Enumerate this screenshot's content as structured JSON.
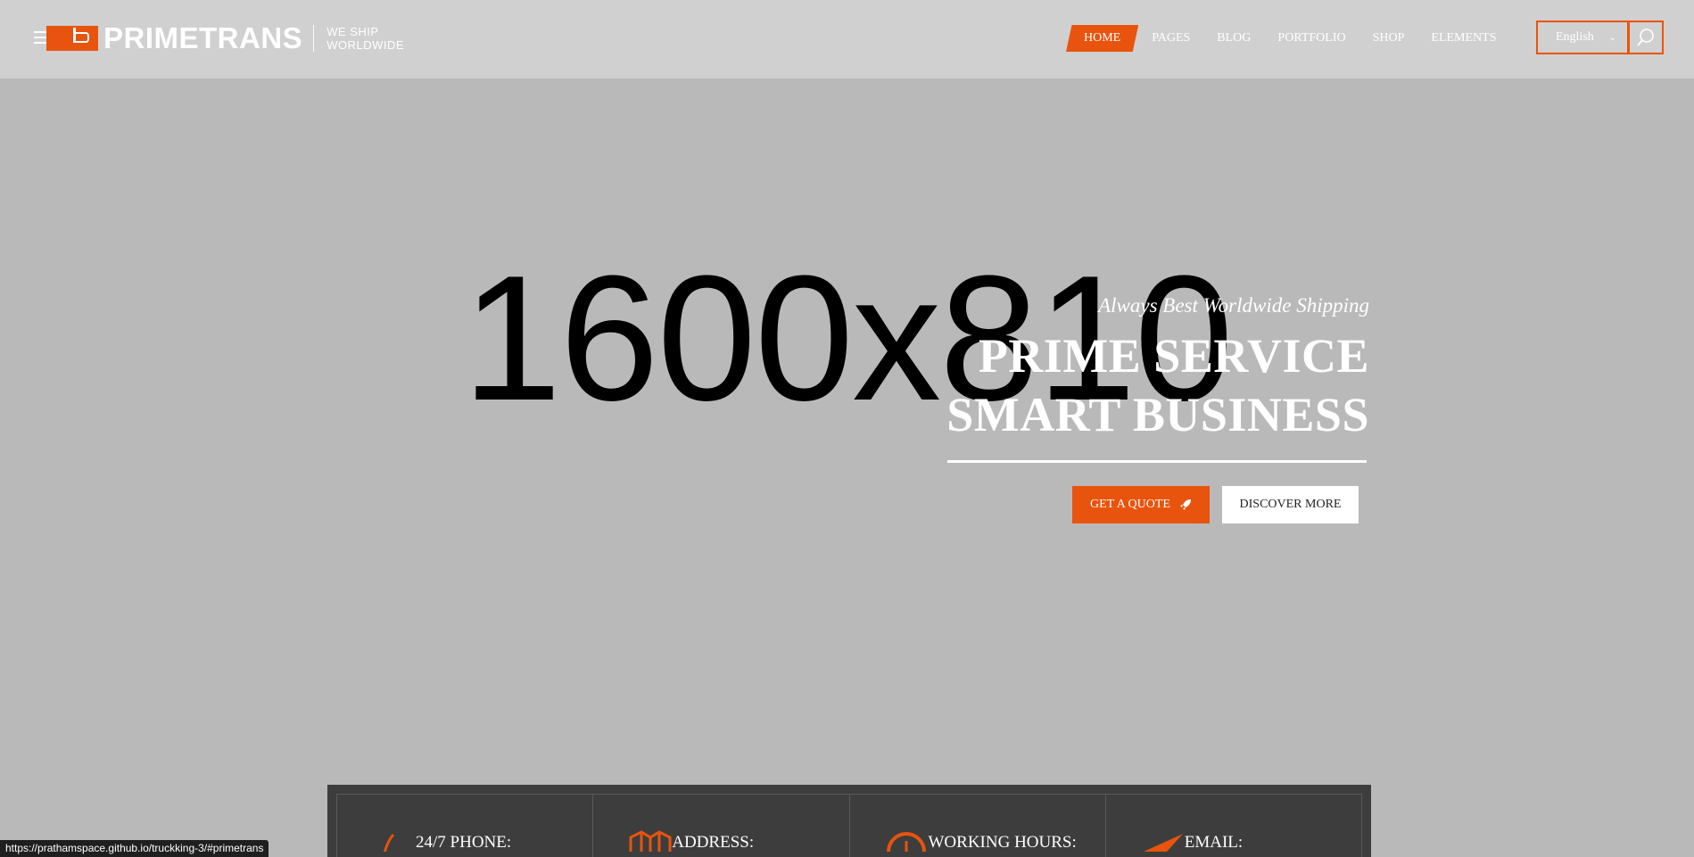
{
  "brand": {
    "name": "PRIMETRANS",
    "tagline_line1": "WE SHIP",
    "tagline_line2": "WORLDWIDE",
    "accent": "#e8540d"
  },
  "nav": {
    "items": [
      {
        "label": "HOME",
        "active": true
      },
      {
        "label": "PAGES",
        "active": false
      },
      {
        "label": "BLOG",
        "active": false
      },
      {
        "label": "PORTFOLIO",
        "active": false
      },
      {
        "label": "SHOP",
        "active": false
      },
      {
        "label": "ELEMENTS",
        "active": false
      }
    ],
    "language": "English",
    "search_icon": "search-icon"
  },
  "hero": {
    "placeholder": "1600x810",
    "tagline": "Always Best Worldwide Shipping",
    "title_line1": "PRIME SERVICE",
    "title_line2": "SMART BUSINESS",
    "cta_quote": "GET A QUOTE",
    "cta_more": "DISCOVER MORE"
  },
  "info": {
    "items": [
      {
        "label": "24/7 PHONE:",
        "icon": "phone-icon"
      },
      {
        "label": "ADDRESS:",
        "icon": "map-icon"
      },
      {
        "label": "WORKING HOURS:",
        "icon": "clock-icon"
      },
      {
        "label": "EMAIL:",
        "icon": "paper-plane-icon"
      }
    ]
  },
  "status_url": "https://prathamspace.github.io/truckking-3/#primetrans"
}
